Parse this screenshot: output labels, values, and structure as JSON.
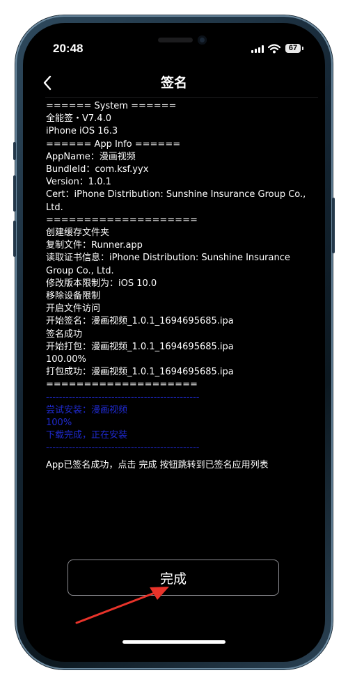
{
  "status_bar": {
    "time": "20:48",
    "battery_level": "67",
    "icons": [
      "signal-icon",
      "wifi-icon",
      "battery-icon"
    ]
  },
  "nav": {
    "title": "签名",
    "back_icon": "chevron-left-icon"
  },
  "log": {
    "lines": [
      "====== System ======",
      "全能签・V7.4.0",
      "iPhone iOS 16.3",
      "====== App Info ======",
      "AppName：漫画视频",
      "BundleId：com.ksf.yyx",
      "Version：1.0.1",
      "Cert：iPhone Distribution: Sunshine Insurance Group Co., Ltd.",
      "====================",
      "创建缓存文件夹",
      "复制文件：Runner.app",
      "读取证书信息：iPhone Distribution: Sunshine Insurance Group Co., Ltd.",
      "修改版本限制为：iOS 10.0",
      "移除设备限制",
      "开启文件访问",
      "开始签名：漫画视频_1.0.1_1694695685.ipa",
      "签名成功",
      "开始打包：漫画视频_1.0.1_1694695685.ipa",
      "100.00%",
      "打包成功：漫画视频_1.0.1_1694695685.ipa",
      "===================="
    ],
    "install_lines": [
      "-----------------------------------------------",
      "尝试安装：漫画视频",
      "100%",
      "下载完成，正在安装",
      "-----------------------------------------------"
    ],
    "note": "App已签名成功，点击 完成 按钮跳转到已签名应用列表"
  },
  "done_button": {
    "label": "完成"
  },
  "colors": {
    "screen_bg": "#000000",
    "text": "#ffffff",
    "install_text": "#1f2ad0",
    "annotation_arrow": "#e8332a"
  }
}
